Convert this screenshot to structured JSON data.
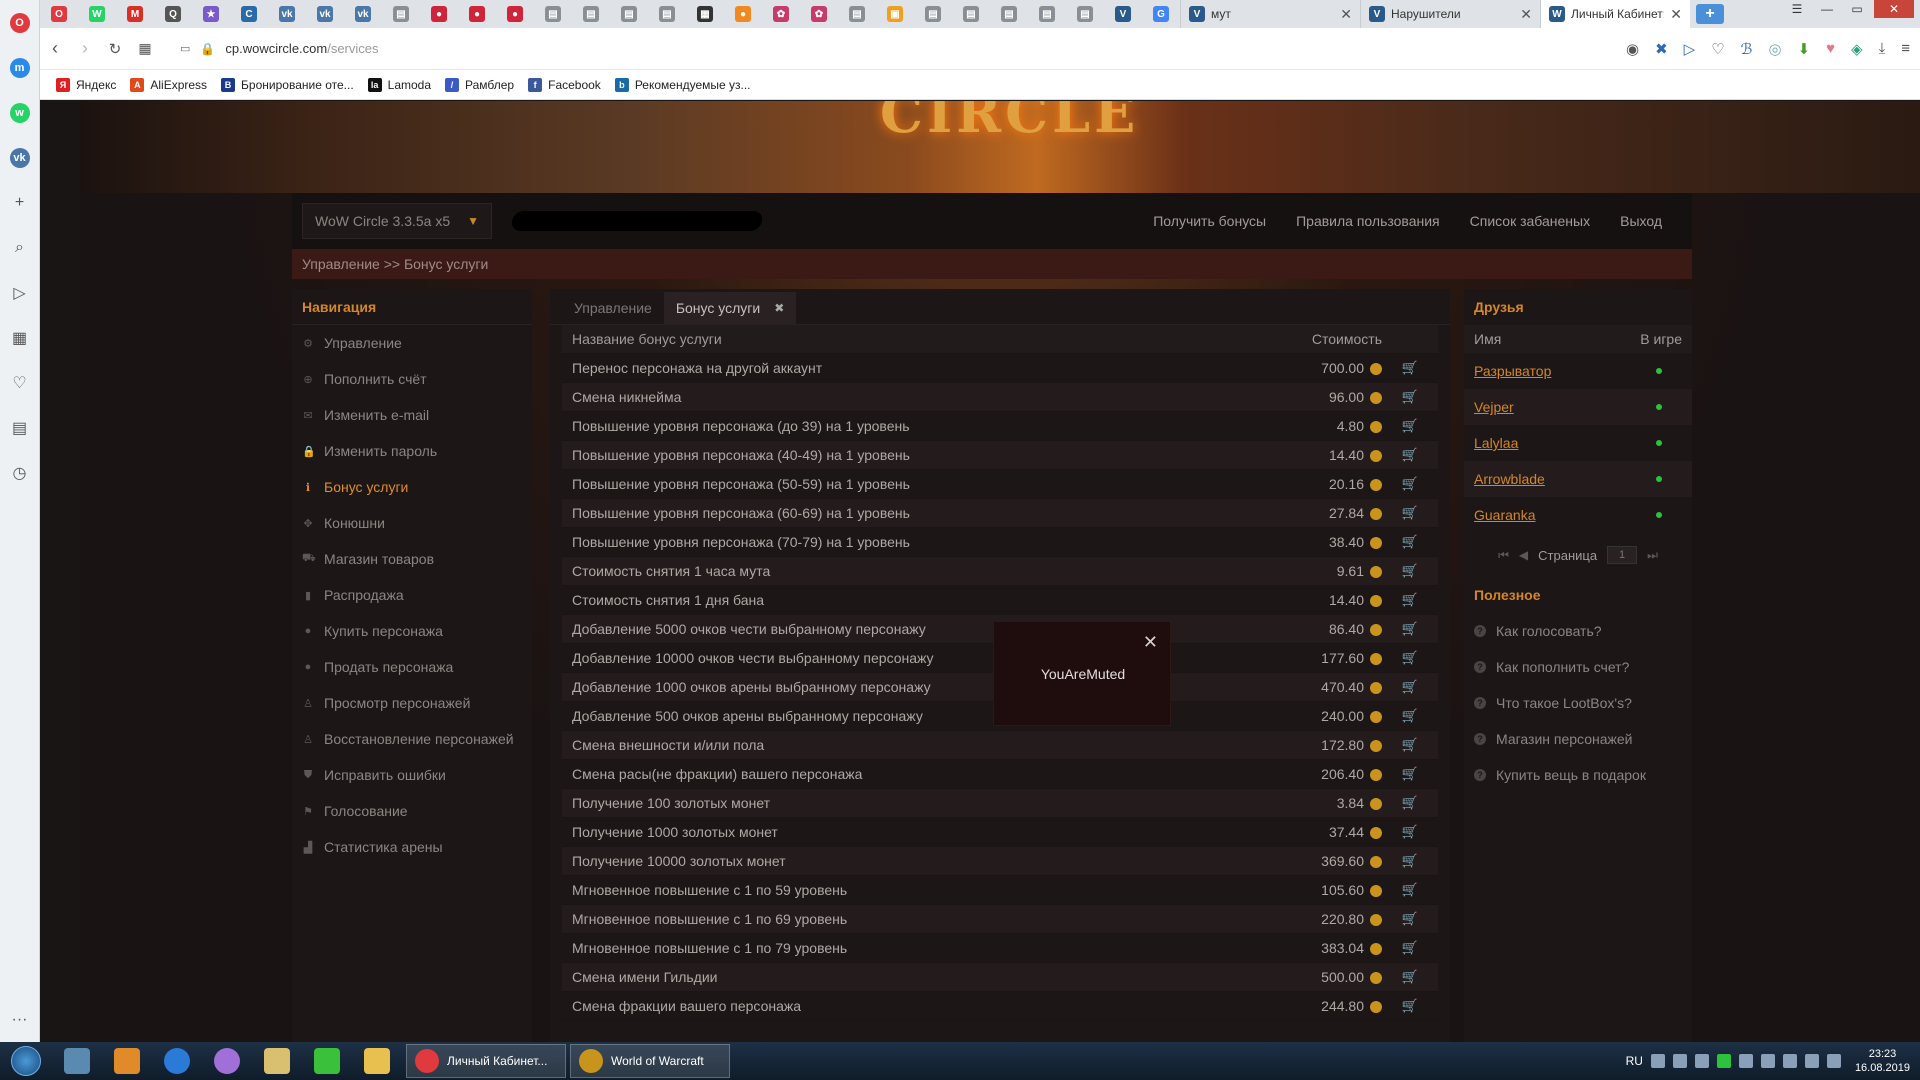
{
  "browser": {
    "tabs_mini": [
      {
        "icon": "opera-icon",
        "color": "#e0393e",
        "glyph": "O"
      },
      {
        "icon": "whatsapp-icon",
        "color": "#25d366",
        "glyph": "W"
      },
      {
        "icon": "gmail-icon",
        "color": "#d93025",
        "glyph": "M"
      },
      {
        "icon": "q-icon",
        "color": "#555555",
        "glyph": "Q"
      },
      {
        "icon": "star-icon",
        "color": "#7a5ac8",
        "glyph": "★"
      },
      {
        "icon": "chat-icon",
        "color": "#2a6aa8",
        "glyph": "C"
      },
      {
        "icon": "vk-icon",
        "color": "#4a76a8",
        "glyph": "vk"
      },
      {
        "icon": "vk-icon",
        "color": "#4a76a8",
        "glyph": "vk"
      },
      {
        "icon": "vk-icon",
        "color": "#4a76a8",
        "glyph": "vk"
      },
      {
        "icon": "page-icon",
        "color": "#8a8f96",
        "glyph": "▤"
      },
      {
        "icon": "red-icon",
        "color": "#d0243a",
        "glyph": "●"
      },
      {
        "icon": "red-icon",
        "color": "#d0243a",
        "glyph": "●"
      },
      {
        "icon": "red-icon",
        "color": "#d0243a",
        "glyph": "●"
      },
      {
        "icon": "page-icon",
        "color": "#8a8f96",
        "glyph": "▤"
      },
      {
        "icon": "page-icon",
        "color": "#8a8f96",
        "glyph": "▤"
      },
      {
        "icon": "page-icon",
        "color": "#8a8f96",
        "glyph": "▤"
      },
      {
        "icon": "page-icon",
        "color": "#8a8f96",
        "glyph": "▤"
      },
      {
        "icon": "film-icon",
        "color": "#333333",
        "glyph": "▦"
      },
      {
        "icon": "orange-icon",
        "color": "#f08a20",
        "glyph": "●"
      },
      {
        "icon": "flower-icon",
        "color": "#c83a6a",
        "glyph": "✿"
      },
      {
        "icon": "flower-icon",
        "color": "#c83a6a",
        "glyph": "✿"
      },
      {
        "icon": "page-icon",
        "color": "#8a8f96",
        "glyph": "▤"
      },
      {
        "icon": "orange-icon",
        "color": "#f0a020",
        "glyph": "▣"
      },
      {
        "icon": "page-icon",
        "color": "#8a8f96",
        "glyph": "▤"
      },
      {
        "icon": "page-icon",
        "color": "#8a8f96",
        "glyph": "▤"
      },
      {
        "icon": "page-icon",
        "color": "#8a8f96",
        "glyph": "▤"
      },
      {
        "icon": "page-icon",
        "color": "#8a8f96",
        "glyph": "▤"
      },
      {
        "icon": "page-icon",
        "color": "#8a8f96",
        "glyph": "▤"
      },
      {
        "icon": "v-icon",
        "color": "#2a5a8a",
        "glyph": "V"
      },
      {
        "icon": "google-icon",
        "color": "#4285f4",
        "glyph": "G"
      }
    ],
    "tabs_wide": [
      {
        "label": "мут",
        "active": false,
        "icon_glyph": "V"
      },
      {
        "label": "Нарушители",
        "active": false,
        "icon_glyph": "V"
      },
      {
        "label": "Личный Кабинет: logo",
        "active": true,
        "icon_glyph": "W"
      }
    ],
    "url_host": "cp.wowcircle.com",
    "url_path": "/services",
    "bookmarks": [
      {
        "label": "Яндекс",
        "color": "#e02020",
        "glyph": "Я",
        "icon": "yandex-icon"
      },
      {
        "label": "AliExpress",
        "color": "#e04a1a",
        "glyph": "A",
        "icon": "aliexpress-icon"
      },
      {
        "label": "Бронирование оте...",
        "color": "#1a3a8a",
        "glyph": "B",
        "icon": "booking-icon"
      },
      {
        "label": "Lamoda",
        "color": "#111111",
        "glyph": "la",
        "icon": "lamoda-icon"
      },
      {
        "label": "Рамблер",
        "color": "#3a5ac8",
        "glyph": "/",
        "icon": "rambler-icon"
      },
      {
        "label": "Facebook",
        "color": "#3b5998",
        "glyph": "f",
        "icon": "facebook-icon"
      },
      {
        "label": "Рекомендуемые уз...",
        "color": "#1a6aa8",
        "glyph": "b",
        "icon": "recommended-icon"
      }
    ],
    "sidebar": [
      {
        "icon": "opera-logo-icon",
        "color": "#e0393e",
        "glyph": "O"
      },
      {
        "icon": "messenger-icon",
        "color": "#2a8ae8",
        "glyph": "m"
      },
      {
        "icon": "whatsapp-icon",
        "color": "#25d366",
        "glyph": "w"
      },
      {
        "icon": "vk-icon",
        "color": "#4a76a8",
        "glyph": "vk"
      },
      {
        "icon": "plus-icon",
        "color": "",
        "glyph": "+"
      },
      {
        "icon": "search-icon",
        "color": "",
        "glyph": "⌕"
      },
      {
        "icon": "send-icon",
        "color": "",
        "glyph": "▷"
      },
      {
        "icon": "grid-icon",
        "color": "",
        "glyph": "▦"
      },
      {
        "icon": "heart-icon",
        "color": "",
        "glyph": "♡"
      },
      {
        "icon": "news-icon",
        "color": "",
        "glyph": "▤"
      },
      {
        "icon": "history-icon",
        "color": "",
        "glyph": "◷"
      }
    ]
  },
  "site": {
    "logo_text": "CIRCLE",
    "realm": "WoW Circle 3.3.5a x5",
    "top_links": [
      "Получить бонусы",
      "Правила пользования",
      "Список забаненых",
      "Выход"
    ],
    "breadcrumb": "Управление >> Бонус услуги",
    "nav_title": "Навигация",
    "nav": [
      {
        "label": "Управление",
        "icon": "gear-icon",
        "glyph": "⚙",
        "active": false
      },
      {
        "label": "Пополнить счёт",
        "icon": "plus-circle-icon",
        "glyph": "⊕",
        "active": false
      },
      {
        "label": "Изменить e-mail",
        "icon": "envelope-icon",
        "glyph": "✉",
        "active": false
      },
      {
        "label": "Изменить пароль",
        "icon": "lock-icon",
        "glyph": "🔒",
        "active": false
      },
      {
        "label": "Бонус услуги",
        "icon": "info-icon",
        "glyph": "ℹ",
        "active": true
      },
      {
        "label": "Конюшни",
        "icon": "paw-icon",
        "glyph": "✥",
        "active": false
      },
      {
        "label": "Магазин товаров",
        "icon": "cart-icon",
        "glyph": "⛟",
        "active": false
      },
      {
        "label": "Распродажа",
        "icon": "bookmark-icon",
        "glyph": "▮",
        "active": false
      },
      {
        "label": "Купить персонажа",
        "icon": "user-icon",
        "glyph": "●",
        "active": false
      },
      {
        "label": "Продать персонажа",
        "icon": "user-icon",
        "glyph": "●",
        "active": false
      },
      {
        "label": "Просмотр персонажей",
        "icon": "figure-icon",
        "glyph": "♙",
        "active": false
      },
      {
        "label": "Восстановление персонажей",
        "icon": "figure-icon",
        "glyph": "♙",
        "active": false
      },
      {
        "label": "Исправить ошибки",
        "icon": "shield-icon",
        "glyph": "⛊",
        "active": false
      },
      {
        "label": "Голосование",
        "icon": "flag-icon",
        "glyph": "⚑",
        "active": false
      },
      {
        "label": "Статистика арены",
        "icon": "chart-icon",
        "glyph": "▟",
        "active": false
      }
    ],
    "tabs": [
      {
        "label": "Управление",
        "active": false
      },
      {
        "label": "Бонус услуги",
        "active": true
      }
    ],
    "table_headers": {
      "name": "Название бонус услуги",
      "price": "Стоимость"
    },
    "services": [
      {
        "name": "Перенос персонажа на другой аккаунт",
        "price": "700.00"
      },
      {
        "name": "Смена никнейма",
        "price": "96.00"
      },
      {
        "name": "Повышение уровня персонажа (до 39) на 1 уровень",
        "price": "4.80"
      },
      {
        "name": "Повышение уровня персонажа (40-49) на 1 уровень",
        "price": "14.40"
      },
      {
        "name": "Повышение уровня персонажа (50-59) на 1 уровень",
        "price": "20.16"
      },
      {
        "name": "Повышение уровня персонажа (60-69) на 1 уровень",
        "price": "27.84"
      },
      {
        "name": "Повышение уровня персонажа (70-79) на 1 уровень",
        "price": "38.40"
      },
      {
        "name": "Стоимость снятия 1 часа мута",
        "price": "9.61"
      },
      {
        "name": "Стоимость снятия 1 дня бана",
        "price": "14.40"
      },
      {
        "name": "Добавление 5000 очков чести выбранному персонажу",
        "price": "86.40"
      },
      {
        "name": "Добавление 10000 очков чести выбранному персонажу",
        "price": "177.60"
      },
      {
        "name": "Добавление 1000 очков арены выбранному персонажу",
        "price": "470.40"
      },
      {
        "name": "Добавление 500 очков арены выбранному персонажу",
        "price": "240.00"
      },
      {
        "name": "Смена внешности и/или пола",
        "price": "172.80"
      },
      {
        "name": "Смена расы(не фракции) вашего персонажа",
        "price": "206.40"
      },
      {
        "name": "Получение 100 золотых монет",
        "price": "3.84"
      },
      {
        "name": "Получение 1000 золотых монет",
        "price": "37.44"
      },
      {
        "name": "Получение 10000 золотых монет",
        "price": "369.60"
      },
      {
        "name": "Мгновенное повышение с 1 по 59 уровень",
        "price": "105.60"
      },
      {
        "name": "Мгновенное повышение с 1 по 69 уровень",
        "price": "220.80"
      },
      {
        "name": "Мгновенное повышение с 1 по 79 уровень",
        "price": "383.04"
      },
      {
        "name": "Смена имени Гильдии",
        "price": "500.00"
      },
      {
        "name": "Смена фракции вашего персонажа",
        "price": "244.80"
      }
    ],
    "modal_message": "YouAreMuted",
    "friends_title": "Друзья",
    "friends_headers": {
      "name": "Имя",
      "status": "В игре"
    },
    "friends": [
      "Разрыватор",
      "Vejper",
      "Lalylaa",
      "Arrowblade",
      "Guaranka"
    ],
    "pager_label": "Страница",
    "pager_value": "1",
    "useful_title": "Полезное",
    "useful": [
      "Как голосовать?",
      "Как пополнить счет?",
      "Что такое LootBox's?",
      "Магазин персонажей",
      "Купить вещь в подарок"
    ]
  },
  "taskbar": {
    "tasks": [
      {
        "label": "Личный Кабинет...",
        "color": "#e0393e",
        "icon": "opera-icon"
      },
      {
        "label": "World of Warcraft",
        "color": "#c8941c",
        "icon": "wow-icon"
      }
    ],
    "lang": "RU",
    "time": "23:23",
    "date": "16.08.2019"
  }
}
